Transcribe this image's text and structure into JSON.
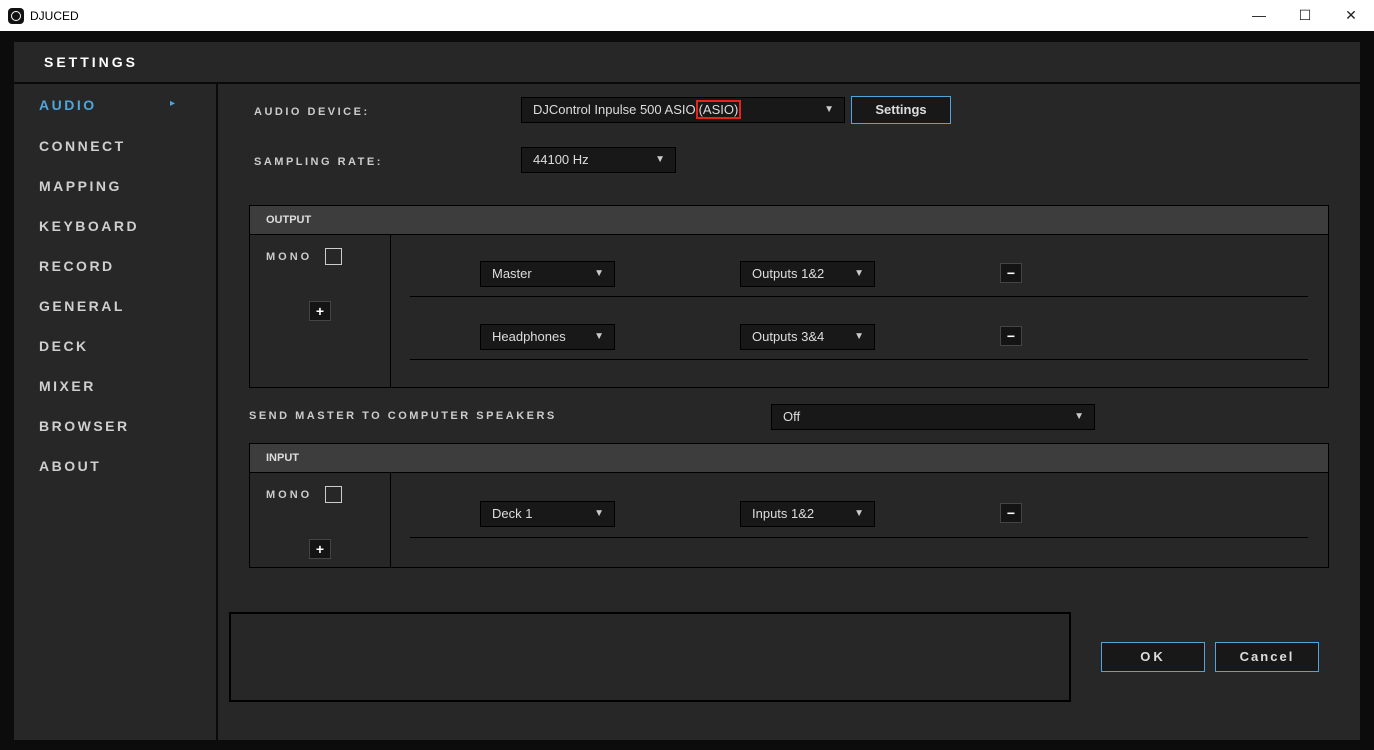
{
  "window": {
    "title": "DJUCED",
    "minimize": "—",
    "maximize": "☐",
    "close": "✕"
  },
  "header": {
    "title": "SETTINGS"
  },
  "sidebar": {
    "items": [
      {
        "label": "AUDIO",
        "active": true
      },
      {
        "label": "CONNECT"
      },
      {
        "label": "MAPPING"
      },
      {
        "label": "KEYBOARD"
      },
      {
        "label": "RECORD"
      },
      {
        "label": "GENERAL"
      },
      {
        "label": "DECK"
      },
      {
        "label": "MIXER"
      },
      {
        "label": "BROWSER"
      },
      {
        "label": "ABOUT"
      }
    ],
    "active_arrow": "▸"
  },
  "audio": {
    "device_label": "AUDIO DEVICE:",
    "device_value": "DJControl Inpulse 500 ASIO",
    "device_highlight": "(ASIO)",
    "settings_button": "Settings",
    "sampling_label": "SAMPLING RATE:",
    "sampling_value": "44100 Hz",
    "highlight_color": "#e8231a",
    "accent": "#4ea6dc"
  },
  "output": {
    "title": "OUTPUT",
    "mono": "MONO",
    "add": "+",
    "rows": [
      {
        "channel": "Master",
        "port": "Outputs 1&2",
        "remove": "−"
      },
      {
        "channel": "Headphones",
        "port": "Outputs 3&4",
        "remove": "−"
      }
    ]
  },
  "send_master": {
    "label": "SEND MASTER TO COMPUTER SPEAKERS",
    "value": "Off"
  },
  "input": {
    "title": "INPUT",
    "mono": "MONO",
    "add": "+",
    "rows": [
      {
        "channel": "Deck 1",
        "port": "Inputs 1&2",
        "remove": "−"
      }
    ]
  },
  "footer": {
    "ok": "OK",
    "cancel": "Cancel"
  },
  "arrow": "▼"
}
